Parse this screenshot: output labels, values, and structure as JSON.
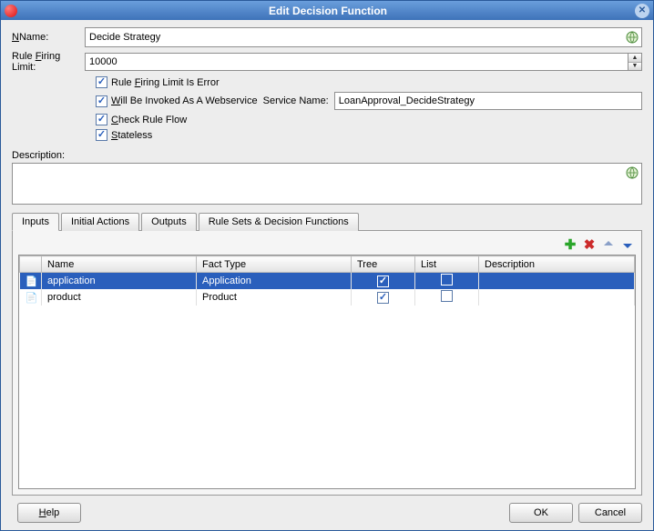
{
  "title": "Edit Decision Function",
  "labels": {
    "name": "Name:",
    "ruleFiringLimit": "Rule Firing Limit:",
    "ruleFiringIsError": "Rule Firing Limit Is Error",
    "invokedWebservice": "Will Be Invoked As A Webservice",
    "serviceName": "Service Name:",
    "checkRuleFlow": "Check Rule Flow",
    "stateless": "Stateless",
    "description": "Description:"
  },
  "values": {
    "name": "Decide Strategy",
    "ruleFiringLimit": "10000",
    "serviceName": "LoanApproval_DecideStrategy",
    "description": ""
  },
  "checkboxes": {
    "ruleFiringIsError": true,
    "invokedWebservice": true,
    "checkRuleFlow": true,
    "stateless": true
  },
  "tabs": [
    "Inputs",
    "Initial Actions",
    "Outputs",
    "Rule Sets & Decision Functions"
  ],
  "activeTab": 0,
  "inputsTable": {
    "columns": [
      "",
      "Name",
      "Fact Type",
      "Tree",
      "List",
      "Description"
    ],
    "rows": [
      {
        "name": "application",
        "factType": "Application",
        "tree": true,
        "list": false,
        "description": "",
        "selected": true
      },
      {
        "name": "product",
        "factType": "Product",
        "tree": true,
        "list": false,
        "description": "",
        "selected": false
      }
    ]
  },
  "buttons": {
    "help": "Help",
    "ok": "OK",
    "cancel": "Cancel"
  }
}
